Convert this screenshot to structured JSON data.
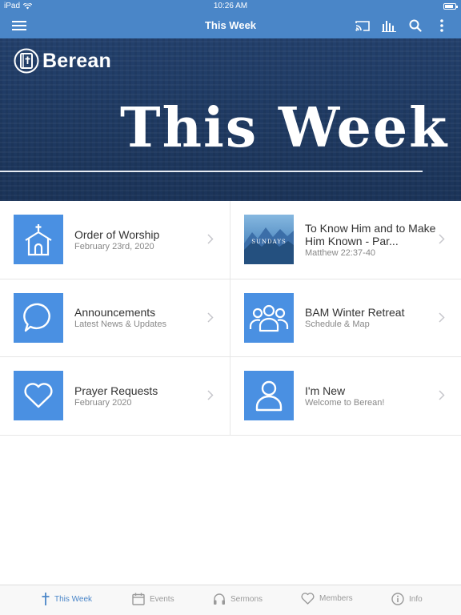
{
  "status": {
    "device": "iPad",
    "time": "10:26 AM"
  },
  "nav": {
    "title": "This Week"
  },
  "banner": {
    "logo_text": "Berean",
    "title": "This Week"
  },
  "items": [
    {
      "title": "Order of Worship",
      "subtitle": "February 23rd, 2020",
      "icon": "church-icon"
    },
    {
      "title": "To Know Him and to Make Him Known - Par...",
      "subtitle": "Matthew 22:37-40",
      "icon": "sermon-thumbnail",
      "thumb_text": "SUNDAYS"
    },
    {
      "title": "Announcements",
      "subtitle": "Latest News & Updates",
      "icon": "speech-bubble-icon"
    },
    {
      "title": "BAM Winter Retreat",
      "subtitle": "Schedule & Map",
      "icon": "group-icon"
    },
    {
      "title": "Prayer Requests",
      "subtitle": "February 2020",
      "icon": "heart-icon"
    },
    {
      "title": "I'm New",
      "subtitle": "Welcome to Berean!",
      "icon": "person-icon"
    }
  ],
  "tabs": [
    {
      "label": "This Week",
      "icon": "cross-icon",
      "active": true
    },
    {
      "label": "Events",
      "icon": "calendar-icon"
    },
    {
      "label": "Sermons",
      "icon": "headphones-icon"
    },
    {
      "label": "Members",
      "icon": "heart-icon"
    },
    {
      "label": "Info",
      "icon": "info-icon"
    }
  ],
  "colors": {
    "accent": "#4a86c8",
    "tile": "#4a90e2",
    "banner": "#1f3a64"
  }
}
